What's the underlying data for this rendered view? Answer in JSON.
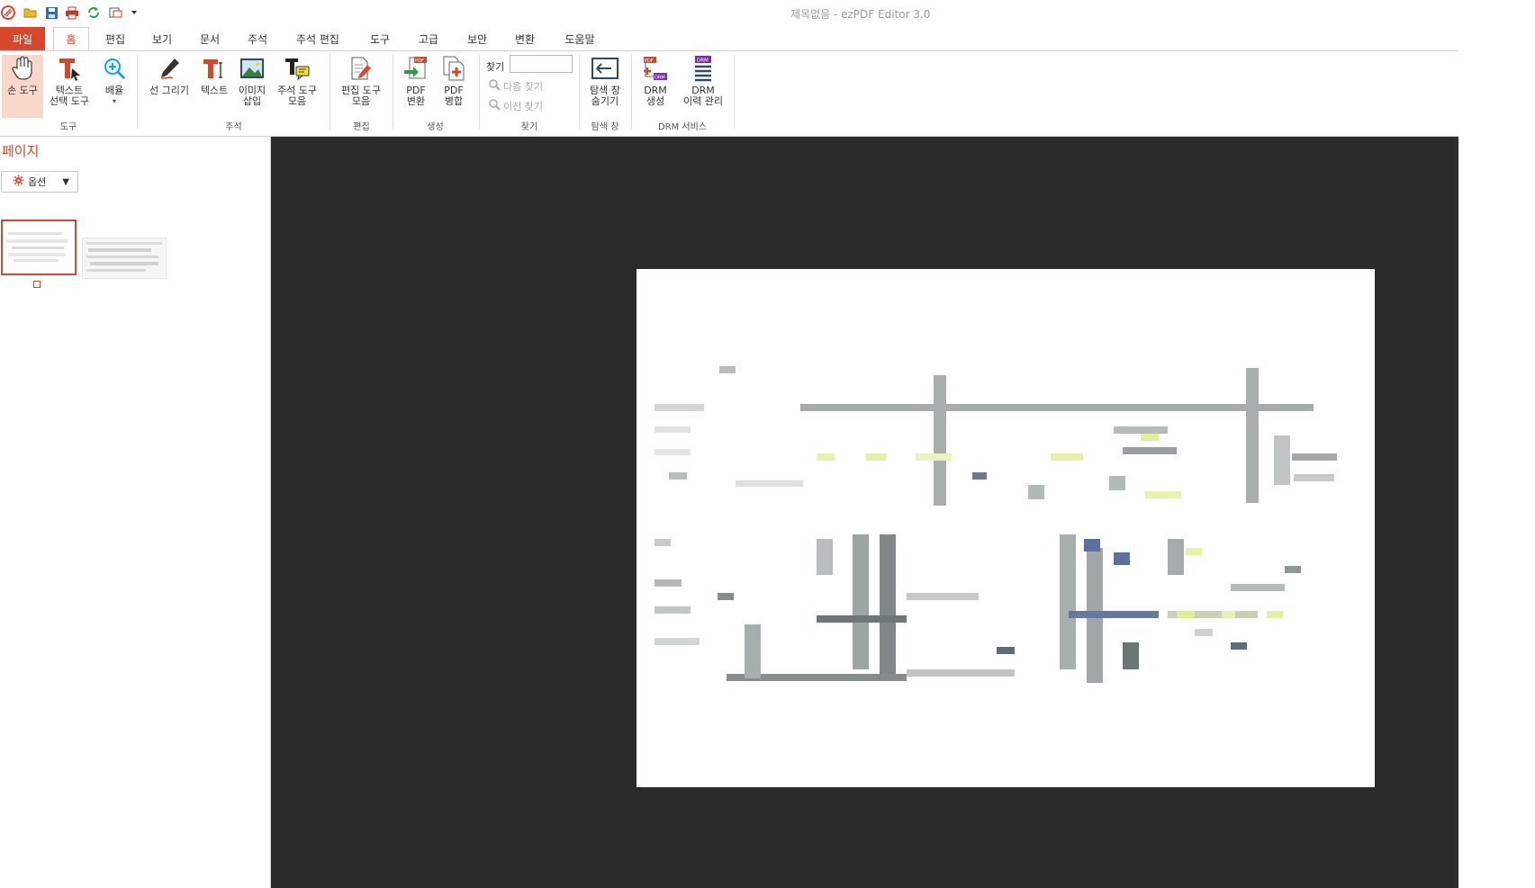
{
  "window": {
    "title": "제목없음 - ezPDF Editor 3.0"
  },
  "quick_access": [
    {
      "name": "app-logo-icon",
      "color": "#d9472b"
    },
    {
      "name": "open-folder-icon",
      "color": "#e8a317"
    },
    {
      "name": "save-icon",
      "color": "#2a6cc7"
    },
    {
      "name": "print-icon",
      "color": "#c0392b"
    },
    {
      "name": "refresh-icon",
      "color": "#2e9d4a"
    },
    {
      "name": "snapshot-icon",
      "color": "#555555"
    },
    {
      "name": "customize-dropdown-icon",
      "color": "#333333"
    }
  ],
  "menu": {
    "file": "파일",
    "tabs": [
      "홈",
      "편집",
      "보기",
      "문서",
      "주석",
      "주석 편집",
      "도구",
      "고급",
      "보안",
      "변환",
      "도움말"
    ],
    "active_tab": "홈"
  },
  "ribbon": {
    "buttons": {
      "hand_tool": "손 도구",
      "text_select": "텍스트\n선택 도구",
      "zoom": "배율",
      "draw_line": "선 그리기",
      "text": "텍스트",
      "insert_image": "이미지\n삽입",
      "annotation_tools": "주석 도구\n모음",
      "edit_tools": "편집 도구\n모음",
      "pdf_convert": "PDF\n변환",
      "pdf_merge": "PDF\n병합",
      "nav_hide": "탐색 창\n숨기기",
      "drm_create": "DRM\n생성",
      "drm_history": "DRM\n이력 관리"
    },
    "groups": {
      "tools": "도구",
      "annotation": "주석",
      "edit": "편집",
      "create": "생성",
      "find": "찾기",
      "nav_pane": "탐색 창",
      "drm": "DRM 서비스"
    },
    "find": {
      "label": "찾기",
      "value": "",
      "next": "다음 찾기",
      "prev": "이전 찾기"
    }
  },
  "sidebar": {
    "title": "페이지",
    "options_button": "옵션"
  },
  "colors": {
    "accent": "#d9472b",
    "viewer_bg": "#2b2b2b",
    "page_bg": "#ffffff",
    "drm_purple": "#7b2f9e"
  }
}
